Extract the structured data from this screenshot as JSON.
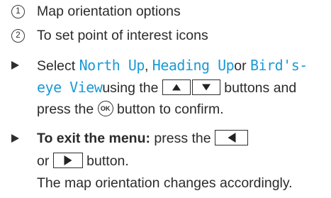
{
  "items": [
    {
      "number": "1",
      "text": "Map orientation options"
    },
    {
      "number": "2",
      "text": "To set point of interest icons"
    }
  ],
  "step1": {
    "lead": "Select ",
    "opt_north": "North Up",
    "sep1": ", ",
    "opt_heading": "Heading Up",
    "or": "or ",
    "opt_birds_1": "Bird's-",
    "opt_birds_2": "eye View",
    "using": "using the ",
    "buttons_and": " buttons and",
    "press_the": "press the ",
    "ok_label": "OK",
    "confirm": " button to confirm."
  },
  "step2": {
    "bold": "To exit the menu:",
    "press_the": " press the ",
    "or": "or ",
    "button": " button.",
    "result": "The map orientation changes accordingly."
  },
  "icons": {
    "up": "up-arrow-icon",
    "down": "down-arrow-icon",
    "left": "left-arrow-icon",
    "right": "right-arrow-icon",
    "ok": "ok-button-icon",
    "bullet": "triangle-bullet-icon"
  },
  "colors": {
    "option_text": "#1a9ad6",
    "body_text": "#2b2b2b"
  }
}
